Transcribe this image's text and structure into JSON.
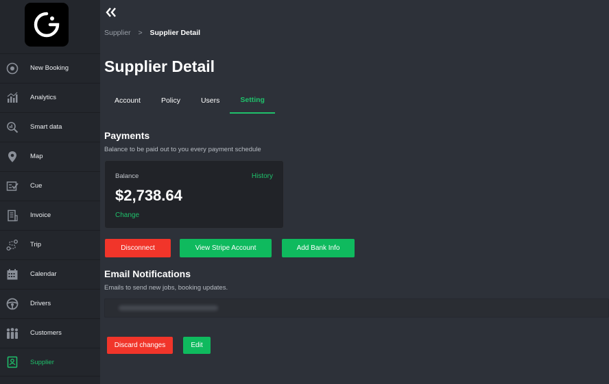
{
  "sidebar": {
    "items": [
      {
        "label": "New Booking",
        "icon": "plus-circle-icon"
      },
      {
        "label": "Analytics",
        "icon": "analytics-icon"
      },
      {
        "label": "Smart data",
        "icon": "search-chart-icon"
      },
      {
        "label": "Map",
        "icon": "map-pin-icon"
      },
      {
        "label": "Cue",
        "icon": "check-list-icon"
      },
      {
        "label": "Invoice",
        "icon": "invoice-icon"
      },
      {
        "label": "Trip",
        "icon": "route-icon"
      },
      {
        "label": "Calendar",
        "icon": "calendar-icon"
      },
      {
        "label": "Drivers",
        "icon": "steering-wheel-icon"
      },
      {
        "label": "Customers",
        "icon": "people-icon"
      },
      {
        "label": "Supplier",
        "icon": "supplier-icon"
      }
    ]
  },
  "header": {
    "breadcrumb": {
      "parent": "Supplier",
      "separator": ">",
      "current": "Supplier Detail"
    },
    "title": "Supplier Detail"
  },
  "tabs": [
    {
      "label": "Account"
    },
    {
      "label": "Policy"
    },
    {
      "label": "Users"
    },
    {
      "label": "Setting"
    }
  ],
  "payments": {
    "title": "Payments",
    "subtitle": "Balance to be paid out to you every payment schedule",
    "balance_label": "Balance",
    "history_label": "History",
    "amount": "$2,738.64",
    "change_label": "Change",
    "disconnect_label": "Disconnect",
    "stripe_label": "View Stripe Account",
    "bank_label": "Add Bank Info"
  },
  "email": {
    "title": "Email Notifications",
    "subtitle": "Emails to send new jobs, booking updates.",
    "discard_label": "Discard changes",
    "edit_label": "Edit"
  },
  "colors": {
    "accent": "#1fc16b",
    "danger": "#f1352a",
    "sidebar_bg": "#23262c",
    "main_bg": "#2d3139",
    "card_bg": "#212328"
  }
}
